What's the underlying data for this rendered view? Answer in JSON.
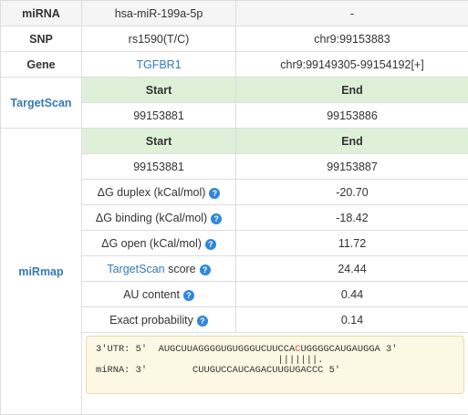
{
  "rows": {
    "mirna": {
      "label": "miRNA",
      "value": "hsa-miR-199a-5p",
      "extra": "-"
    },
    "snp": {
      "label": "SNP",
      "value": "rs1590(T/C)",
      "position": "chr9:99153883"
    },
    "gene": {
      "label": "Gene",
      "value": "TGFBR1",
      "position": "chr9:99149305-99154192[+]"
    }
  },
  "targetscan": {
    "label": "TargetScan",
    "start_header": "Start",
    "end_header": "End",
    "start": "99153881",
    "end": "99153886"
  },
  "mirmap": {
    "label": "miRmap",
    "start_header": "Start",
    "end_header": "End",
    "start": "99153881",
    "end": "99153887",
    "metrics": [
      {
        "label": "ΔG duplex (kCal/mol)",
        "value": "-20.70"
      },
      {
        "label": "ΔG binding (kCal/mol)",
        "value": "-18.42"
      },
      {
        "label": "ΔG open (kCal/mol)",
        "value": "11.72"
      },
      {
        "link": "TargetScan",
        "label": " score",
        "value": "24.44"
      },
      {
        "label": "AU content",
        "value": "0.44"
      },
      {
        "label": "Exact probability",
        "value": "0.14"
      }
    ],
    "alignment": {
      "utr_prefix": "3'UTR: 5'  AUGCUUAGGGGUGUGGGUCUUCCA",
      "utr_highlight": "C",
      "utr_suffix": "UGGGGCAUGAUGGA 3'",
      "pairs": "                                |||||||.",
      "mirna": "miRNA: 3'        CUUGUCCAUCAGACUUGUGACCC 5'"
    }
  },
  "info_glyph": "?",
  "colors": {
    "link": "#337ab7",
    "header_green": "#dff0d8",
    "muted_gray": "#f5f5f5",
    "info_blue": "#2e86de",
    "alignment_bg": "#fcf8e3",
    "mismatch_red": "#d9534f"
  }
}
